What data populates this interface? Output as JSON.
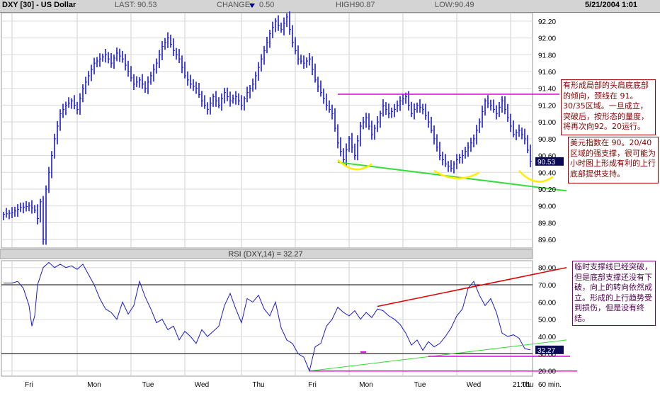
{
  "header": {
    "symbol": "DXY [30] - US Dollar",
    "last_label": "LAST:",
    "last_value": "90.53",
    "change_label": "CHANGE:",
    "change_icon": "triangle-down-icon",
    "change_value": "0.50",
    "high_label": "HIGH:",
    "high_value": "90.87",
    "low_label": "LOW:",
    "low_value": "90.49",
    "datetime": "5/21/2004 1:01"
  },
  "rsi_title": "RSI (DXY,14) = 32.27",
  "x_axis": {
    "day_labels": [
      "Fri",
      "Mon",
      "Tue",
      "Wed",
      "Thu",
      "Fri",
      "Mon",
      "Tue",
      "Wed",
      "Thu"
    ],
    "time_label": "21:01",
    "interval_label": "60 min."
  },
  "annotations": {
    "pattern": "有形成局部的头肩底底部的倾向，颈线在 91。30/35区域。一旦成立，突破后，按形态的量度，将再次向92。20运行。",
    "support": "美元指数在 90。20/40区域的强支撑，很可能为小时图上形成有利的上行底部提供支持。",
    "rsi": "临时支撑线已经突破，但是底部支撑还没有下破，向上的转向依然成立。形成的上行趋势受到损伤，但是没有终结。"
  },
  "colors": {
    "price": "#1a1ad0",
    "neckline": "#e000e0",
    "support_line": "#33dd33",
    "shoulders": "#ffee00",
    "rsi_upper_trend": "#e00000",
    "note_border": "#b00000",
    "note_text": "#8a0000",
    "rsi_note_border": "#800080",
    "rsi_note_text": "#500050",
    "header_bg": "#d4d4d4"
  },
  "chart_data": [
    {
      "type": "candlestick",
      "title": "DXY [30] - US Dollar",
      "interval": "60 min.",
      "ylim": [
        89.5,
        92.3
      ],
      "yticks": [
        89.6,
        89.8,
        90.0,
        90.2,
        90.4,
        90.6,
        90.8,
        91.0,
        91.2,
        91.4,
        91.6,
        91.8,
        92.0,
        92.2
      ],
      "ytick_labels": [
        "89.60",
        "89.80",
        "90.00",
        "90.20",
        "90.40",
        "90.60",
        "90.80",
        "91.00",
        "91.20",
        "91.40",
        "91.60",
        "91.80",
        "92.00",
        "92.20"
      ],
      "last_value": 90.53,
      "last_label": "90.53",
      "close_path": [
        [
          0,
          89.9
        ],
        [
          3,
          89.92
        ],
        [
          6,
          89.98
        ],
        [
          9,
          90.0
        ],
        [
          11,
          89.95
        ],
        [
          12,
          89.85
        ],
        [
          13,
          90.05
        ],
        [
          14,
          89.6
        ],
        [
          15,
          90.2
        ],
        [
          17,
          90.6
        ],
        [
          18,
          90.8
        ],
        [
          19,
          90.95
        ],
        [
          20,
          91.1
        ],
        [
          22,
          91.2
        ],
        [
          24,
          91.25
        ],
        [
          26,
          91.15
        ],
        [
          28,
          91.4
        ],
        [
          30,
          91.55
        ],
        [
          32,
          91.7
        ],
        [
          34,
          91.75
        ],
        [
          36,
          91.8
        ],
        [
          38,
          91.7
        ],
        [
          40,
          91.82
        ],
        [
          42,
          91.75
        ],
        [
          44,
          91.6
        ],
        [
          46,
          91.45
        ],
        [
          48,
          91.5
        ],
        [
          50,
          91.4
        ],
        [
          52,
          91.55
        ],
        [
          54,
          91.7
        ],
        [
          56,
          91.9
        ],
        [
          58,
          92.0
        ],
        [
          60,
          91.85
        ],
        [
          62,
          91.75
        ],
        [
          64,
          91.55
        ],
        [
          66,
          91.45
        ],
        [
          68,
          91.4
        ],
        [
          70,
          91.25
        ],
        [
          72,
          91.15
        ],
        [
          74,
          91.3
        ],
        [
          76,
          91.2
        ],
        [
          78,
          91.35
        ],
        [
          80,
          91.25
        ],
        [
          82,
          91.3
        ],
        [
          84,
          91.2
        ],
        [
          86,
          91.35
        ],
        [
          88,
          91.45
        ],
        [
          90,
          91.65
        ],
        [
          92,
          91.85
        ],
        [
          94,
          92.05
        ],
        [
          96,
          92.2
        ],
        [
          98,
          92.1
        ],
        [
          100,
          92.25
        ],
        [
          102,
          91.95
        ],
        [
          104,
          91.75
        ],
        [
          106,
          91.7
        ],
        [
          108,
          91.75
        ],
        [
          110,
          91.5
        ],
        [
          112,
          91.35
        ],
        [
          114,
          91.2
        ],
        [
          116,
          91.1
        ],
        [
          118,
          90.75
        ],
        [
          120,
          90.55
        ],
        [
          122,
          90.8
        ],
        [
          124,
          90.6
        ],
        [
          126,
          90.95
        ],
        [
          128,
          91.05
        ],
        [
          130,
          90.85
        ],
        [
          132,
          91.0
        ],
        [
          134,
          91.2
        ],
        [
          136,
          91.1
        ],
        [
          138,
          91.15
        ],
        [
          140,
          91.25
        ],
        [
          142,
          91.3
        ],
        [
          144,
          91.1
        ],
        [
          146,
          91.2
        ],
        [
          148,
          91.15
        ],
        [
          150,
          91.0
        ],
        [
          152,
          90.8
        ],
        [
          154,
          90.6
        ],
        [
          156,
          90.5
        ],
        [
          158,
          90.45
        ],
        [
          160,
          90.55
        ],
        [
          162,
          90.6
        ],
        [
          164,
          90.7
        ],
        [
          166,
          90.8
        ],
        [
          168,
          91.0
        ],
        [
          170,
          91.25
        ],
        [
          172,
          91.2
        ],
        [
          174,
          91.1
        ],
        [
          176,
          91.25
        ],
        [
          178,
          91.05
        ],
        [
          180,
          90.85
        ],
        [
          182,
          90.9
        ],
        [
          184,
          90.8
        ],
        [
          186,
          90.53
        ]
      ]
    },
    {
      "type": "line",
      "title": "RSI (DXY,14) = 32.27",
      "ylim": [
        17,
        84
      ],
      "yticks": [
        20,
        30,
        40,
        50,
        60,
        70,
        80
      ],
      "ytick_labels": [
        "20.00",
        "30.00",
        "40.00",
        "50.00",
        "60.00",
        "70.00",
        "80.00"
      ],
      "reference_lines": [
        70,
        30
      ],
      "last_value": 32.27,
      "last_label": "32.27",
      "series": [
        {
          "points": [
            [
              0,
              71
            ],
            [
              3,
              71
            ],
            [
              5,
              72
            ],
            [
              7,
              68
            ],
            [
              9,
              58
            ],
            [
              10,
              46
            ],
            [
              11,
              52
            ],
            [
              12,
              70
            ],
            [
              14,
              80
            ],
            [
              16,
              83
            ],
            [
              18,
              80
            ],
            [
              20,
              82
            ],
            [
              22,
              80
            ],
            [
              24,
              81
            ],
            [
              26,
              79
            ],
            [
              28,
              82
            ],
            [
              30,
              76
            ],
            [
              32,
              70
            ],
            [
              34,
              62
            ],
            [
              36,
              56
            ],
            [
              38,
              54
            ],
            [
              40,
              50
            ],
            [
              42,
              60
            ],
            [
              44,
              53
            ],
            [
              46,
              58
            ],
            [
              48,
              72
            ],
            [
              50,
              63
            ],
            [
              52,
              56
            ],
            [
              54,
              48
            ],
            [
              56,
              50
            ],
            [
              58,
              44
            ],
            [
              60,
              46
            ],
            [
              62,
              38
            ],
            [
              64,
              43
            ],
            [
              66,
              40
            ],
            [
              68,
              36
            ],
            [
              70,
              44
            ],
            [
              72,
              40
            ],
            [
              74,
              43
            ],
            [
              76,
              46
            ],
            [
              78,
              58
            ],
            [
              80,
              65
            ],
            [
              82,
              56
            ],
            [
              84,
              48
            ],
            [
              86,
              62
            ],
            [
              88,
              60
            ],
            [
              90,
              64
            ],
            [
              92,
              56
            ],
            [
              94,
              52
            ],
            [
              96,
              60
            ],
            [
              98,
              45
            ],
            [
              100,
              38
            ],
            [
              102,
              36
            ],
            [
              104,
              30
            ],
            [
              106,
              28
            ],
            [
              108,
              20
            ],
            [
              110,
              34
            ],
            [
              112,
              36
            ],
            [
              114,
              46
            ],
            [
              116,
              50
            ],
            [
              118,
              57
            ],
            [
              120,
              54
            ],
            [
              122,
              52
            ],
            [
              124,
              55
            ],
            [
              126,
              50
            ],
            [
              128,
              54
            ],
            [
              130,
              51
            ],
            [
              132,
              56
            ],
            [
              134,
              55
            ],
            [
              136,
              52
            ],
            [
              138,
              50
            ],
            [
              140,
              47
            ],
            [
              142,
              42
            ],
            [
              144,
              35
            ],
            [
              146,
              38
            ],
            [
              148,
              32
            ],
            [
              150,
              37
            ],
            [
              152,
              34
            ],
            [
              154,
              36
            ],
            [
              156,
              40
            ],
            [
              158,
              45
            ],
            [
              160,
              52
            ],
            [
              162,
              56
            ],
            [
              164,
              68
            ],
            [
              166,
              72
            ],
            [
              168,
              64
            ],
            [
              170,
              58
            ],
            [
              172,
              62
            ],
            [
              174,
              54
            ],
            [
              176,
              42
            ],
            [
              178,
              40
            ],
            [
              180,
              41
            ],
            [
              182,
              39
            ],
            [
              184,
              33
            ],
            [
              186,
              32.27
            ]
          ]
        }
      ]
    }
  ]
}
